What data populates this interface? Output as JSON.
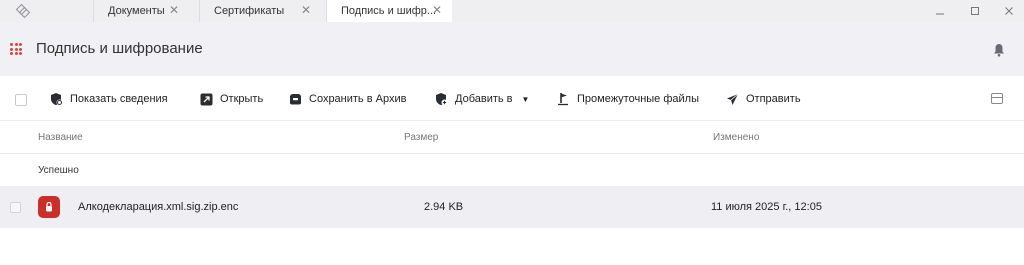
{
  "tabs": [
    {
      "label": "Документы"
    },
    {
      "label": "Сертификаты"
    },
    {
      "label": "Подпись и шифр..."
    }
  ],
  "header": {
    "title": "Подпись и шифрование"
  },
  "toolbar": {
    "show_details": "Показать сведения",
    "open": "Открыть",
    "save_archive": "Сохранить в Архив",
    "add_to": "Добавить в",
    "intermediate_files": "Промежуточные файлы",
    "send": "Отправить"
  },
  "table": {
    "columns": {
      "name": "Название",
      "size": "Размер",
      "modified": "Изменено"
    },
    "group_label": "Успешно",
    "rows": [
      {
        "name": "Алкодекларация.xml.sig.zip.enc",
        "size": "2.94 KB",
        "modified": "11 июля 2025 г., 12:05"
      }
    ]
  },
  "colors": {
    "accent": "#d9463b",
    "file_icon": "#c9302c",
    "header_bg": "#f1f1f5",
    "row_bg": "#efeff3"
  }
}
